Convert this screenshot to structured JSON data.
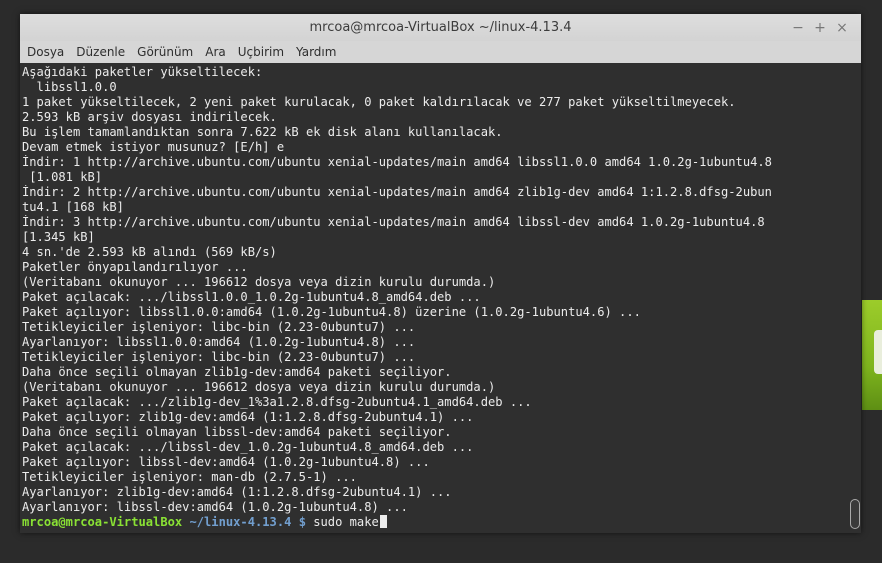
{
  "window": {
    "title": "mrcoa@mrcoa-VirtualBox ~/linux-4.13.4",
    "controls": {
      "minimize": "−",
      "maximize": "+",
      "close": "×"
    }
  },
  "menu": [
    "Dosya",
    "Düzenle",
    "Görünüm",
    "Ara",
    "Uçbirim",
    "Yardım"
  ],
  "terminal": {
    "lines": [
      "Aşağıdaki paketler yükseltilecek:",
      "  libssl1.0.0",
      "1 paket yükseltilecek, 2 yeni paket kurulacak, 0 paket kaldırılacak ve 277 paket yükseltilmeyecek.",
      "2.593 kB arşiv dosyası indirilecek.",
      "Bu işlem tamamlandıktan sonra 7.622 kB ek disk alanı kullanılacak.",
      "Devam etmek istiyor musunuz? [E/h] e",
      "İndir: 1 http://archive.ubuntu.com/ubuntu xenial-updates/main amd64 libssl1.0.0 amd64 1.0.2g-1ubuntu4.8",
      " [1.081 kB]",
      "İndir: 2 http://archive.ubuntu.com/ubuntu xenial-updates/main amd64 zlib1g-dev amd64 1:1.2.8.dfsg-2ubun",
      "tu4.1 [168 kB]",
      "İndir: 3 http://archive.ubuntu.com/ubuntu xenial-updates/main amd64 libssl-dev amd64 1.0.2g-1ubuntu4.8",
      "[1.345 kB]",
      "4 sn.'de 2.593 kB alındı (569 kB/s)",
      "Paketler önyapılandırılıyor ...",
      "(Veritabanı okunuyor ... 196612 dosya veya dizin kurulu durumda.)",
      "Paket açılacak: .../libssl1.0.0_1.0.2g-1ubuntu4.8_amd64.deb ...",
      "Paket açılıyor: libssl1.0.0:amd64 (1.0.2g-1ubuntu4.8) üzerine (1.0.2g-1ubuntu4.6) ...",
      "Tetikleyiciler işleniyor: libc-bin (2.23-0ubuntu7) ...",
      "Ayarlanıyor: libssl1.0.0:amd64 (1.0.2g-1ubuntu4.8) ...",
      "Tetikleyiciler işleniyor: libc-bin (2.23-0ubuntu7) ...",
      "Daha önce seçili olmayan zlib1g-dev:amd64 paketi seçiliyor.",
      "(Veritabanı okunuyor ... 196612 dosya veya dizin kurulu durumda.)",
      "Paket açılacak: .../zlib1g-dev_1%3a1.2.8.dfsg-2ubuntu4.1_amd64.deb ...",
      "Paket açılıyor: zlib1g-dev:amd64 (1:1.2.8.dfsg-2ubuntu4.1) ...",
      "Daha önce seçili olmayan libssl-dev:amd64 paketi seçiliyor.",
      "Paket açılacak: .../libssl-dev_1.0.2g-1ubuntu4.8_amd64.deb ...",
      "Paket açılıyor: libssl-dev:amd64 (1.0.2g-1ubuntu4.8) ...",
      "Tetikleyiciler işleniyor: man-db (2.7.5-1) ...",
      "Ayarlanıyor: zlib1g-dev:amd64 (1:1.2.8.dfsg-2ubuntu4.1) ...",
      "Ayarlanıyor: libssl-dev:amd64 (1.0.2g-1ubuntu4.8) ..."
    ],
    "prompt": {
      "user_host": "mrcoa@mrcoa-VirtualBox",
      "path": "~/linux-4.13.4",
      "symbol": "$",
      "command": "sudo make"
    }
  },
  "colors": {
    "terminal_bg": "#2f2f2f",
    "terminal_fg": "#ececec",
    "prompt_user": "#8ae234",
    "prompt_path": "#729fcf"
  }
}
